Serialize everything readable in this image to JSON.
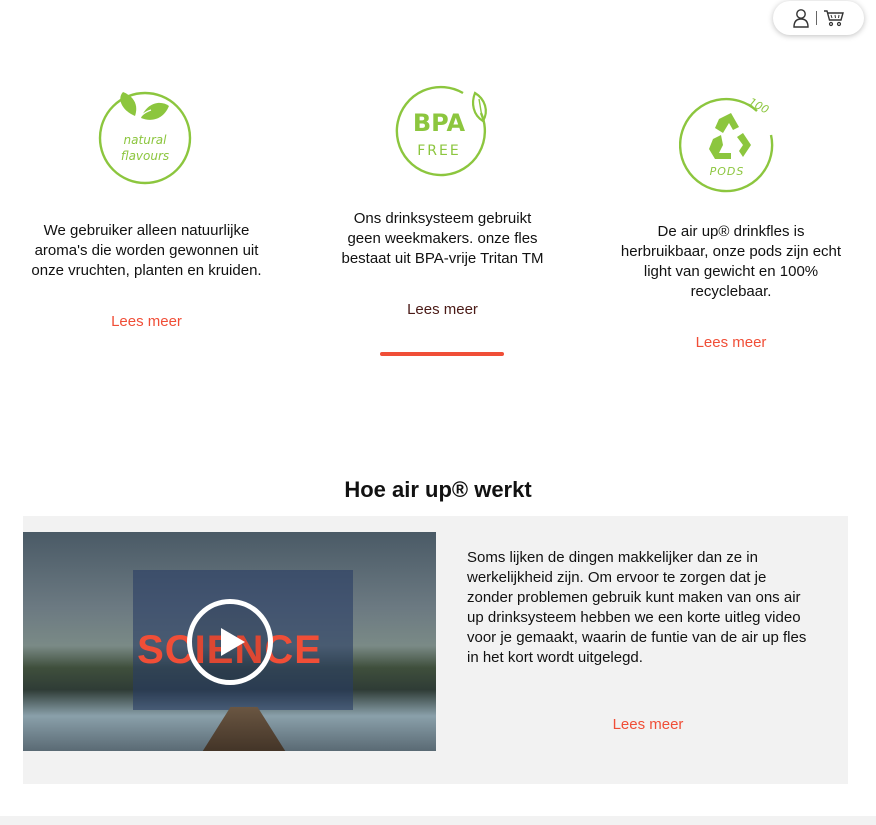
{
  "header": {
    "account_icon": "user-icon",
    "cart_icon": "cart-icon"
  },
  "features": [
    {
      "icon": "natural-flavours-badge",
      "badge_text": [
        "natural",
        "flavours"
      ],
      "text": "We gebruiker alleen natuurlijke aroma's die worden gewonnen uit onze vruchten, planten en kruiden.",
      "link": "Lees meer"
    },
    {
      "icon": "bpa-free-badge",
      "badge_text": [
        "BPA",
        "FREE"
      ],
      "text": "Ons drinksysteem gebruikt geen weekmakers. onze fles bestaat uit BPA-vrije Tritan TM",
      "link": "Lees meer",
      "active": true
    },
    {
      "icon": "recycle-100-badge",
      "badge_text": [
        "100",
        "PODS"
      ],
      "text": "De air up® drinkfles is herbruikbaar, onze pods zijn echt light van gewicht en 100% recyclebaar.",
      "link": "Lees meer"
    }
  ],
  "how_it_works": {
    "title": "Hoe air up® werkt",
    "video": {
      "word": "SCIENCE",
      "play_icon": "play-icon"
    },
    "text": "Soms lijken de dingen makkelijker dan ze in werkelijkheid zijn. Om ervoor te zorgen dat je zonder problemen gebruik kunt maken van ons air up drinksysteem hebben we een korte uitleg video voor je gemaakt, waarin de funtie van de air up fles in het kort wordt uitgelegd.",
    "link": "Lees meer"
  },
  "colors": {
    "brand_green": "#8cc63e",
    "accent_red": "#f04e37",
    "card_bg": "#f2f2f2"
  }
}
